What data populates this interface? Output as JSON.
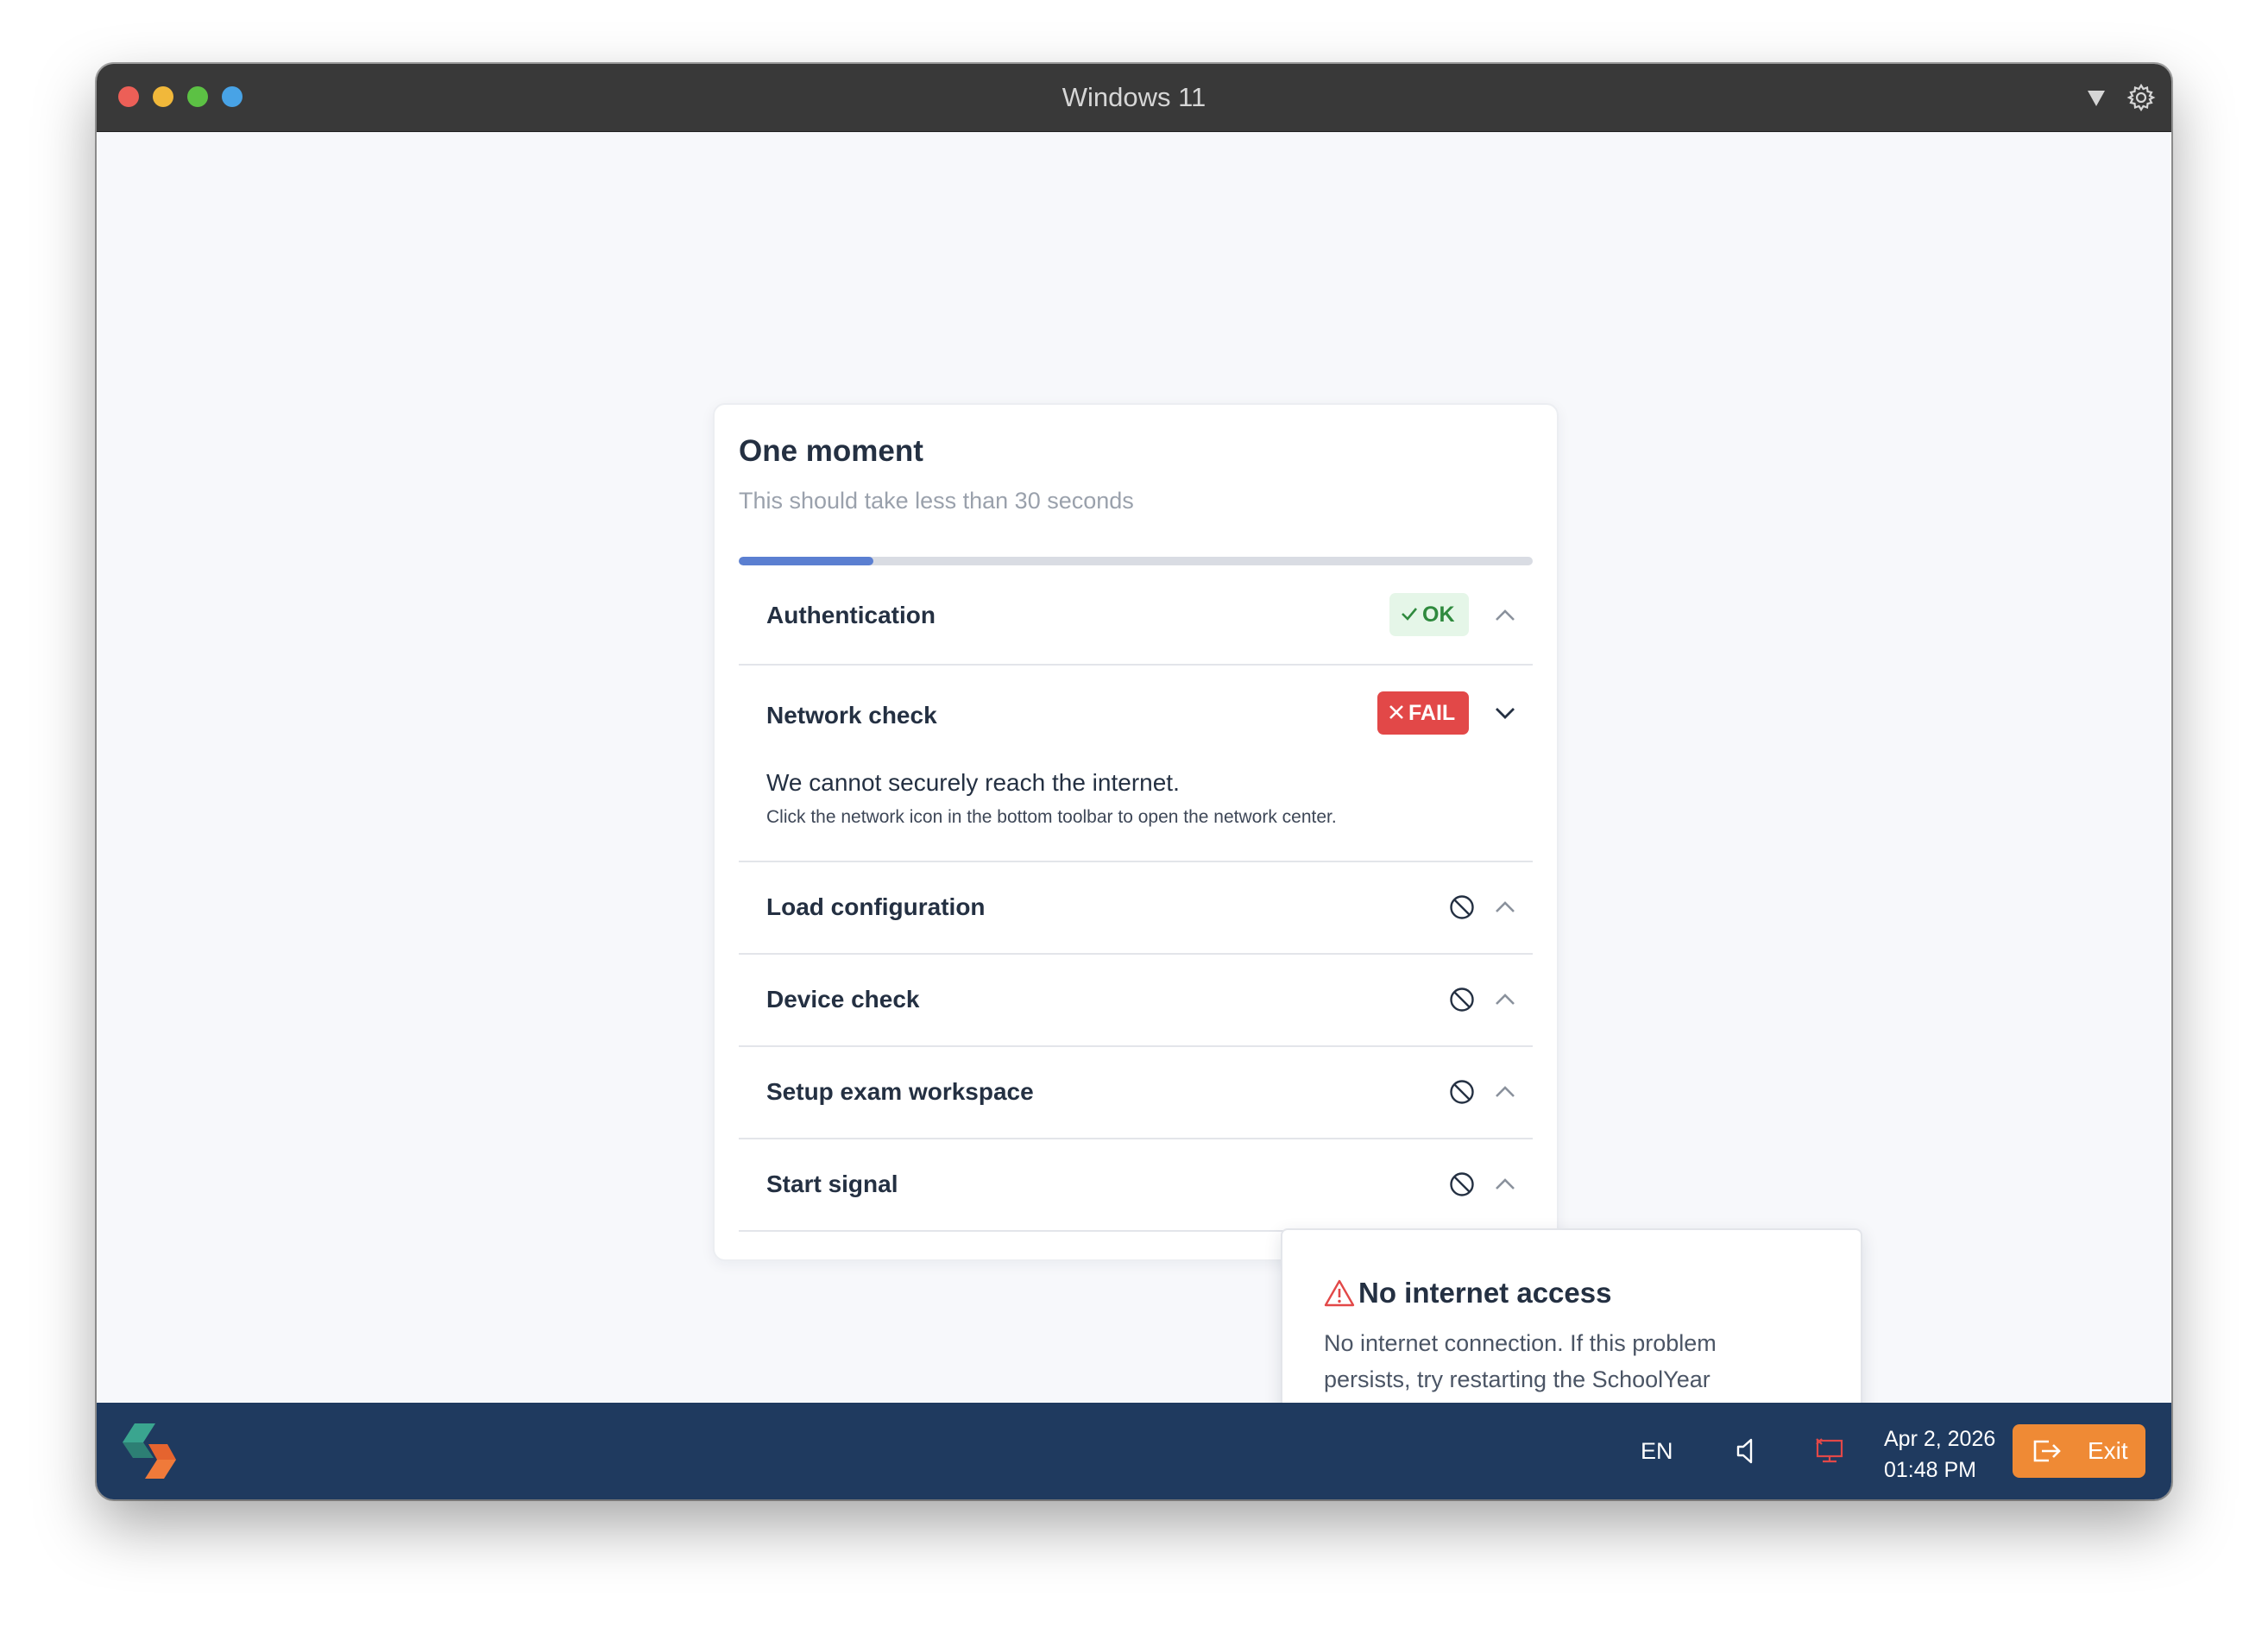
{
  "window": {
    "title": "Windows 11"
  },
  "card": {
    "title": "One moment",
    "subtitle": "This should take less than 30 seconds",
    "progress": 0.17
  },
  "steps": [
    {
      "label": "Authentication",
      "status": "OK",
      "expanded": false
    },
    {
      "label": "Network check",
      "status": "FAIL",
      "expanded": true,
      "message": "We cannot securely reach the internet.",
      "hint": "Click the network icon in the bottom toolbar to open the network center."
    },
    {
      "label": "Load configuration",
      "status": "blocked",
      "expanded": false
    },
    {
      "label": "Device check",
      "status": "blocked",
      "expanded": false
    },
    {
      "label": "Setup exam workspace",
      "status": "blocked",
      "expanded": false
    },
    {
      "label": "Start signal",
      "status": "blocked",
      "expanded": false
    }
  ],
  "popover": {
    "title": "No internet access",
    "body": "No internet connection. If this problem persists, try restarting the SchoolYear application."
  },
  "taskbar": {
    "language": "EN",
    "date": "Apr 2, 2026",
    "time": "01:48 PM",
    "exit_label": "Exit"
  },
  "colors": {
    "accent": "#5b7fd1",
    "ok": "#2f8a3e",
    "fail": "#e24848",
    "taskbar": "#1f3a5f",
    "exit": "#ef8a35"
  },
  "icons": [
    "dropdown-icon",
    "gear-icon",
    "check-icon",
    "close-icon",
    "chevron-up-icon",
    "chevron-down-icon",
    "blocked-icon",
    "warning-icon",
    "speaker-icon",
    "network-disconnected-icon",
    "exit-icon",
    "schoolyear-logo"
  ]
}
